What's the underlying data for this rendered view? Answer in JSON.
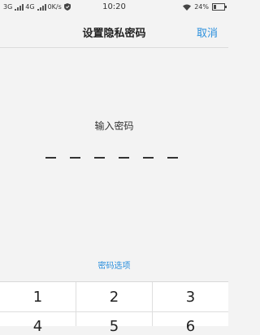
{
  "status_bar": {
    "network_left": "3G",
    "network_right": "4G",
    "speed": "0K/s",
    "time": "10:20",
    "battery": "24%"
  },
  "nav": {
    "title": "设置隐私密码",
    "cancel_label": "取消"
  },
  "main": {
    "prompt": "输入密码",
    "password_length": 6
  },
  "options_link": "密码选项",
  "keypad": {
    "row1": [
      "1",
      "2",
      "3"
    ],
    "row2_partial": [
      "4",
      "5",
      "6"
    ]
  },
  "colors": {
    "accent": "#2a8fdd",
    "background": "#f3f3f3",
    "keypad_bg": "#ffffff"
  }
}
